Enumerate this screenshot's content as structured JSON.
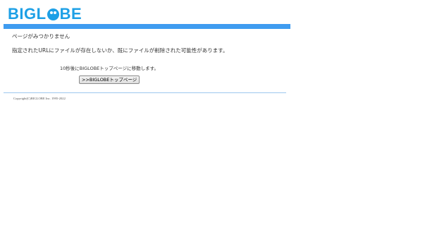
{
  "brand": {
    "logo_prefix": "BIGL",
    "logo_suffix": "BE",
    "color": "#1ea0e6",
    "bar_color": "#3f9cf0"
  },
  "page": {
    "title": "ページがみつかりません",
    "message": "指定されたURLにファイルが存在しないか、既にファイルが削除された可能性があります。",
    "redirect_notice": "10秒後にBIGLOBEトップページに移動します。",
    "top_button_label": ">>BIGLOBEトップページ"
  },
  "footer": {
    "copyright": "Copyright(C)BIGLOBE Inc. 1995-2022"
  }
}
